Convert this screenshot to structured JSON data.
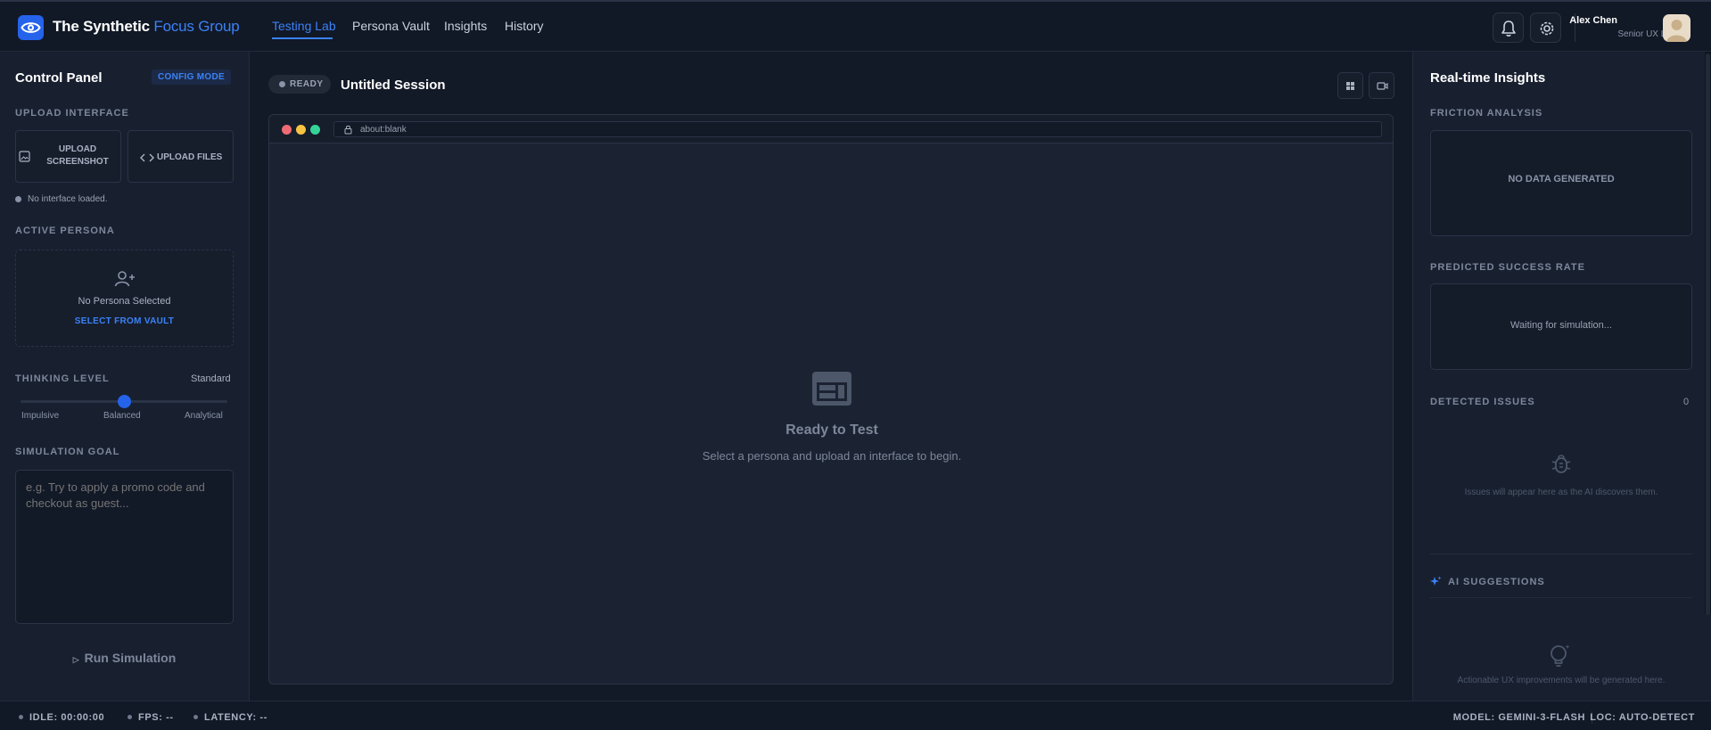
{
  "app": {
    "title_main": "The Synthetic",
    "title_accent": "Focus Group",
    "nav_tabs": [
      "Testing Lab",
      "Persona Vault",
      "Insights",
      "History"
    ],
    "active_tab": "Testing Lab",
    "accent_color": "#3b82f6",
    "icons": {
      "logo": "eye-icon",
      "notifications": "bell-icon",
      "settings": "gear-icon"
    }
  },
  "user": {
    "name": "Alex Chen",
    "role": "Senior UX Lead"
  },
  "control_panel": {
    "title": "Control Panel",
    "mode_badge": "CONFIG MODE",
    "upload_section_label": "UPLOAD INTERFACE",
    "upload_screenshot_label": "UPLOAD SCREENSHOT",
    "upload_files_label": "UPLOAD FILES",
    "upload_status": "No interface loaded.",
    "persona_section_label": "ACTIVE PERSONA",
    "persona_status": "No Persona Selected",
    "select_vault_label": "SELECT FROM VAULT",
    "thinking_label": "THINKING LEVEL",
    "thinking_value": "Standard",
    "thinking_options": [
      "Impulsive",
      "Balanced",
      "Analytical"
    ],
    "thinking_level_fraction": 0.5,
    "goal_label": "SIMULATION GOAL",
    "goal_placeholder": "e.g. Try to apply a promo code and checkout as guest...",
    "goal_value": "",
    "run_label": "Run Simulation"
  },
  "session": {
    "status": "READY",
    "title": "Untitled Session",
    "url": "about:blank",
    "empty_title": "Ready to Test",
    "empty_subtitle": "Select a persona and upload an interface to begin.",
    "traffic_colors": [
      "#ef6b73",
      "#f6c343",
      "#34d399"
    ]
  },
  "insights": {
    "title": "Real-time Insights",
    "friction_label": "FRICTION ANALYSIS",
    "friction_empty": "NO DATA GENERATED",
    "success_label": "PREDICTED SUCCESS RATE",
    "success_empty": "Waiting for simulation...",
    "issues_label": "DETECTED ISSUES",
    "issues_count": "0",
    "issues_empty": "Issues will appear here as the AI discovers them.",
    "suggestions_label": "AI SUGGESTIONS",
    "suggestions_empty": "Actionable UX improvements will be generated here."
  },
  "status_bar": {
    "idle": "IDLE: 00:00:00",
    "fps": "FPS: --",
    "latency": "LATENCY: --",
    "model": "MODEL: GEMINI-3-FLASH",
    "loc": "LOC: AUTO-DETECT"
  }
}
